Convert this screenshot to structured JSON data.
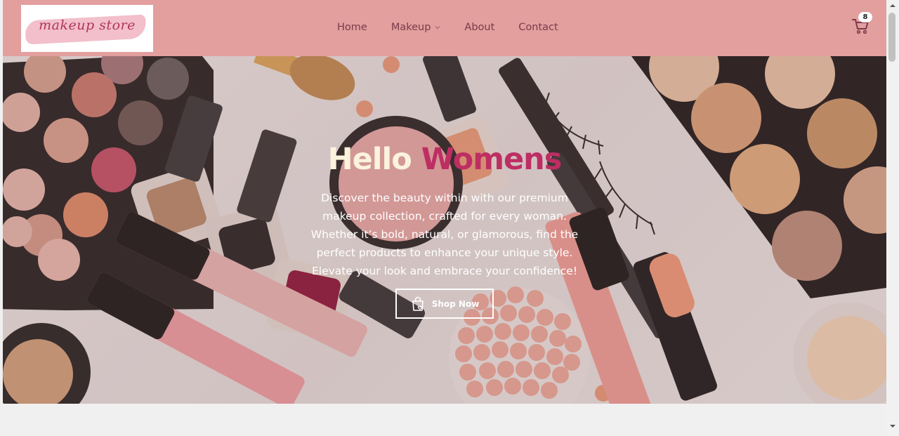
{
  "brand": {
    "logo_text": "makeup store"
  },
  "nav": {
    "items": [
      {
        "label": "Home",
        "has_dropdown": false
      },
      {
        "label": "Makeup",
        "has_dropdown": true
      },
      {
        "label": "About",
        "has_dropdown": false
      },
      {
        "label": "Contact",
        "has_dropdown": false
      }
    ]
  },
  "cart": {
    "count": "8",
    "icon": "cart-icon"
  },
  "hero": {
    "title_part1": "Hello",
    "title_part2": "Womens",
    "description": "Discover the beauty within with our premium makeup collection, crafted for every woman. Whether it’s bold, natural, or glamorous, find the perfect products to enhance your unique style. Elevate your look and embrace your confidence!",
    "button_label": "Shop Now",
    "button_icon": "shopping-bag-heart-icon"
  },
  "colors": {
    "header_bg": "#e39e9e",
    "nav_text": "#7a3b4a",
    "accent": "#bd2e63",
    "title_cream": "#fbf3dc"
  }
}
